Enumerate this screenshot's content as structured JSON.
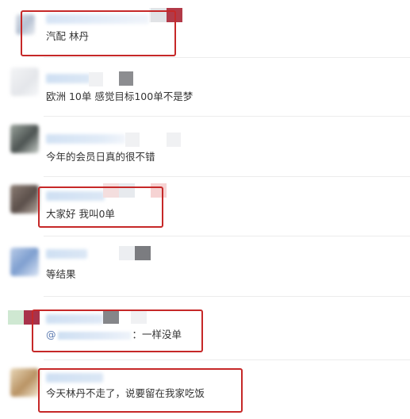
{
  "comments": [
    {
      "text": "汽配 林丹"
    },
    {
      "text": "欧洲 10单 感觉目标100单不是梦"
    },
    {
      "text": "今年的会员日真的很不错"
    },
    {
      "text": "大家好 我叫0单"
    },
    {
      "text": "等结果"
    },
    {
      "mention_prefix": "@",
      "text": "：一样没单"
    },
    {
      "text": "今天林丹不走了，说要留在我家吃饭"
    }
  ],
  "colors": {
    "highlight": "#c62828",
    "text": "#333333",
    "mention": "#5b7ab0",
    "divider": "#ececec"
  }
}
